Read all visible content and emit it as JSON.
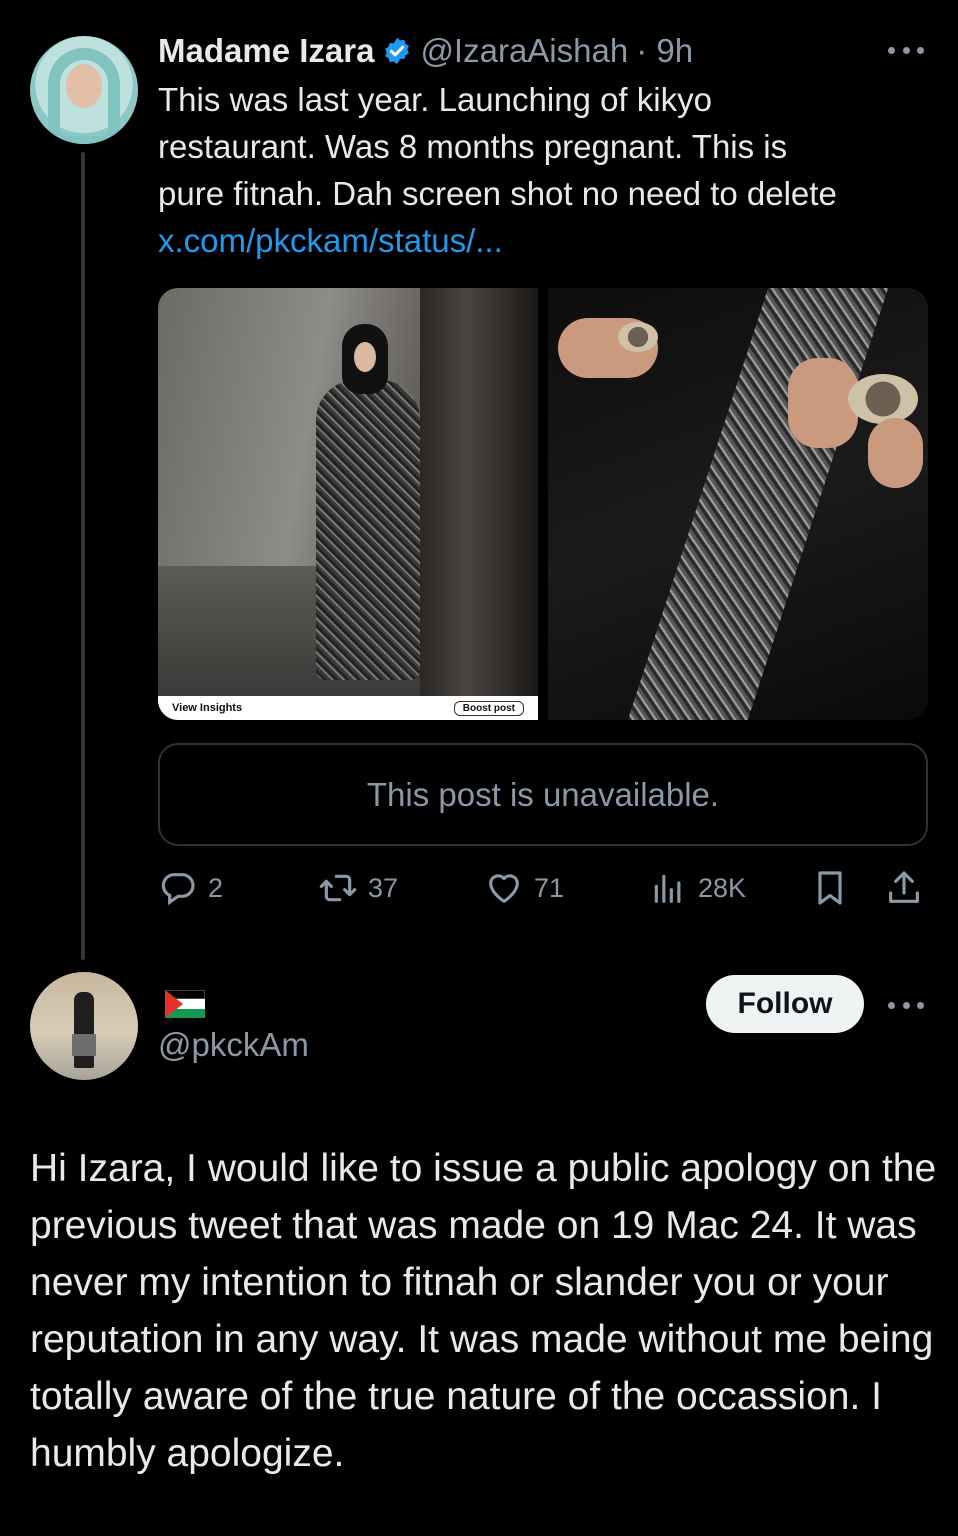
{
  "tweet": {
    "author_name": "Madame Izara",
    "handle": "@IzaraAishah",
    "time": "· 9h",
    "text_lines": [
      "This was last year. Launching of  kikyo",
      "restaurant. Was 8 months pregnant. This is",
      "pure fitnah. Dah screen shot no need to delete"
    ],
    "link": "x.com/pkckam/status/...",
    "media_left": {
      "view_insights": "View Insights",
      "boost_post": "Boost post"
    },
    "quote_unavailable": "This post is unavailable.",
    "actions": {
      "replies": "2",
      "reposts": "37",
      "likes": "71",
      "views": "28K"
    }
  },
  "reply": {
    "handle": "@pkckAm",
    "follow_label": "Follow",
    "text": "Hi Izara, I would like to issue a public apology on the previous tweet that was made on 19 Mac 24. It was never my intention to fitnah or slander you or your reputation in any way. It was made without me being totally aware of the true nature of the occassion. I humbly apologize."
  },
  "colors": {
    "background": "#000000",
    "text": "#e7e9ea",
    "muted": "#8b98a5",
    "link": "#1d9bf0",
    "verified": "#1d9bf0",
    "follow_bg": "#eff3f4"
  },
  "icons": [
    "verified-badge-icon",
    "more-icon",
    "reply-icon",
    "repost-icon",
    "like-icon",
    "views-icon",
    "bookmark-icon",
    "share-icon",
    "palestine-flag-icon"
  ]
}
